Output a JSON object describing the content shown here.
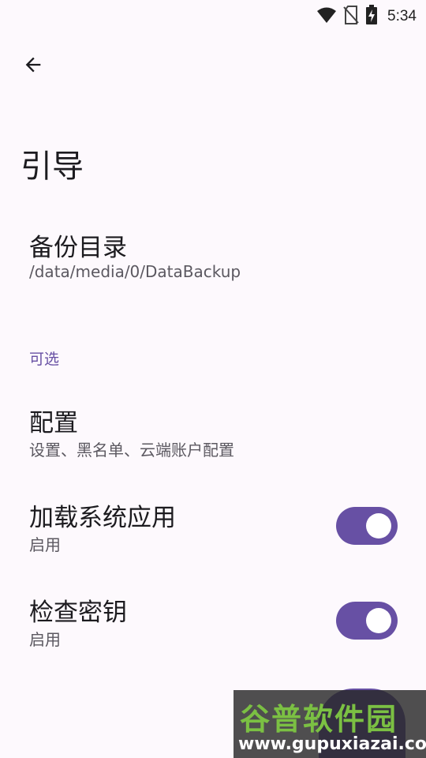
{
  "status_bar": {
    "time": "5:34",
    "icons": [
      "wifi-icon",
      "no-sim-icon",
      "battery-charging-icon"
    ]
  },
  "toolbar": {
    "back_icon": "arrow-left-icon"
  },
  "page": {
    "title": "引导"
  },
  "backup_directory": {
    "title": "备份目录",
    "summary": "/data/media/0/DataBackup"
  },
  "optional_category": {
    "label": "可选"
  },
  "config": {
    "title": "配置",
    "summary": "设置、黑名单、云端账户配置"
  },
  "load_system_apps": {
    "title": "加载系统应用",
    "summary": "启用",
    "enabled": true
  },
  "check_keys": {
    "title": "检查密钥",
    "summary": "启用",
    "enabled": true
  },
  "watermark": {
    "name": "谷普软件园",
    "url": "www.gupuxiazai.com"
  },
  "colors": {
    "accent": "#6750a4",
    "background": "#fdf9fd",
    "watermark_green": "#7bc043"
  }
}
